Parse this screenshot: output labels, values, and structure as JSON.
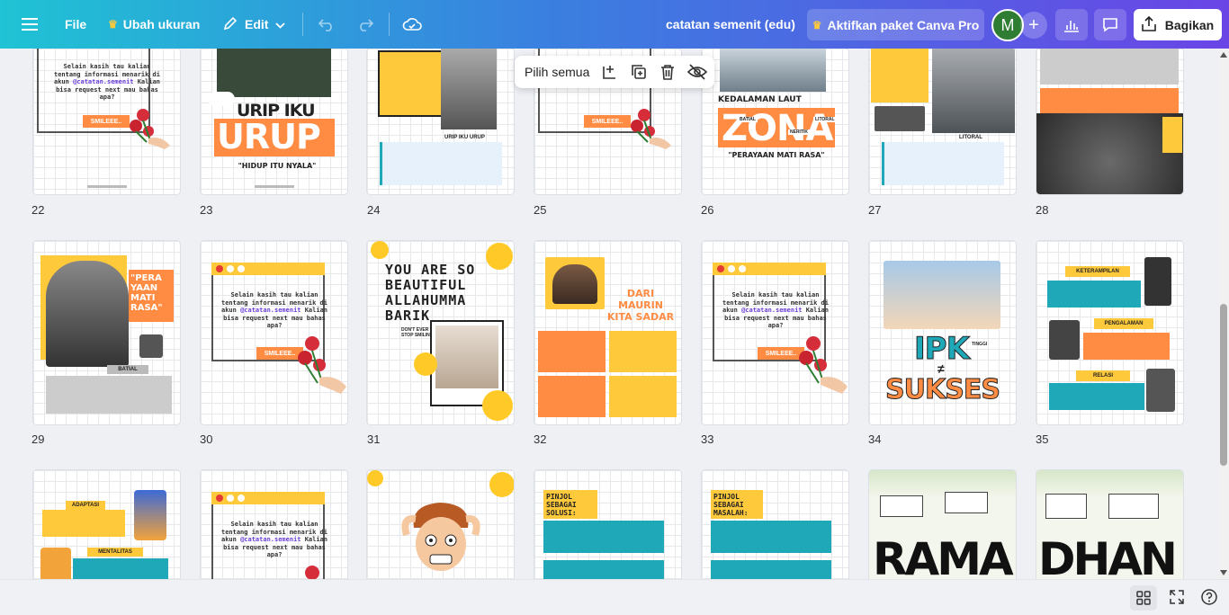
{
  "topbar": {
    "file_label": "File",
    "resize_label": "Ubah ukuran",
    "edit_label": "Edit",
    "doc_title": "catatan semenit (edu)",
    "pro_label": "Aktifkan paket Canva Pro",
    "avatar_letter": "M",
    "share_label": "Bagikan"
  },
  "context_menu": {
    "select_all_label": "Pilih semua"
  },
  "pages": {
    "row1": [
      "22",
      "23",
      "24",
      "25",
      "26",
      "27",
      "28"
    ],
    "row2": [
      "29",
      "30",
      "31",
      "32",
      "33",
      "34",
      "35"
    ]
  },
  "cards": {
    "info_text": "Selain kasih tau kalian tentang informasi menarik di akun",
    "handle": "@catatan.semenit",
    "request_text": "Kalian bisa request next mau bahas apa?",
    "smile_tag": "SMILEEE..",
    "urip_line1": "URIP IKU",
    "urip_line2": "URUP",
    "urip_sub": "\"HIDUP ITU NYALA\"",
    "urip_caption": "URIP IKU URUP",
    "zona_top": "KEDALAMAN LAUT",
    "zona_big": "ZONA",
    "zona_sub": "\"PERAYAAN MATI RASA\"",
    "zona_batial": "BATIAL",
    "zona_neritik": "NERITIK",
    "zona_litoral": "LITORAL",
    "litoral_tag": "LITORAL",
    "perayaan": "\"PERA YAAN MATI RASA\"",
    "batial_tag": "BATIAL",
    "beautiful": "YOU ARE SO BEAUTIFUL ALLAHUMMA BARIK",
    "dont_stop": "DON'T EVER STOP SMILING",
    "maurin_title": "DARI MAURIN KITA SADAR",
    "ipk": "IPK",
    "sukses": "SUKSES",
    "neq": "≠",
    "ipk_tinggi": "TINGGI",
    "keterampilan": "KETERAMPILAN",
    "pengalaman": "PENGALAMAN",
    "relasi": "RELASI",
    "adaptasi": "ADAPTASI",
    "mentalitas": "MENTALITAS",
    "pinjol_solusi": "PINJOL SEBAGAI SOLUSI:",
    "pinjol_masalah": "PINJOL SEBAGAI MASALAH:",
    "rama": "RAMA",
    "dhan": "DHAN"
  },
  "colors": {
    "accent_orange": "#ff8c42",
    "accent_yellow": "#ffc93c",
    "accent_teal": "#1ea8b8",
    "purple": "#6b3fd8"
  }
}
